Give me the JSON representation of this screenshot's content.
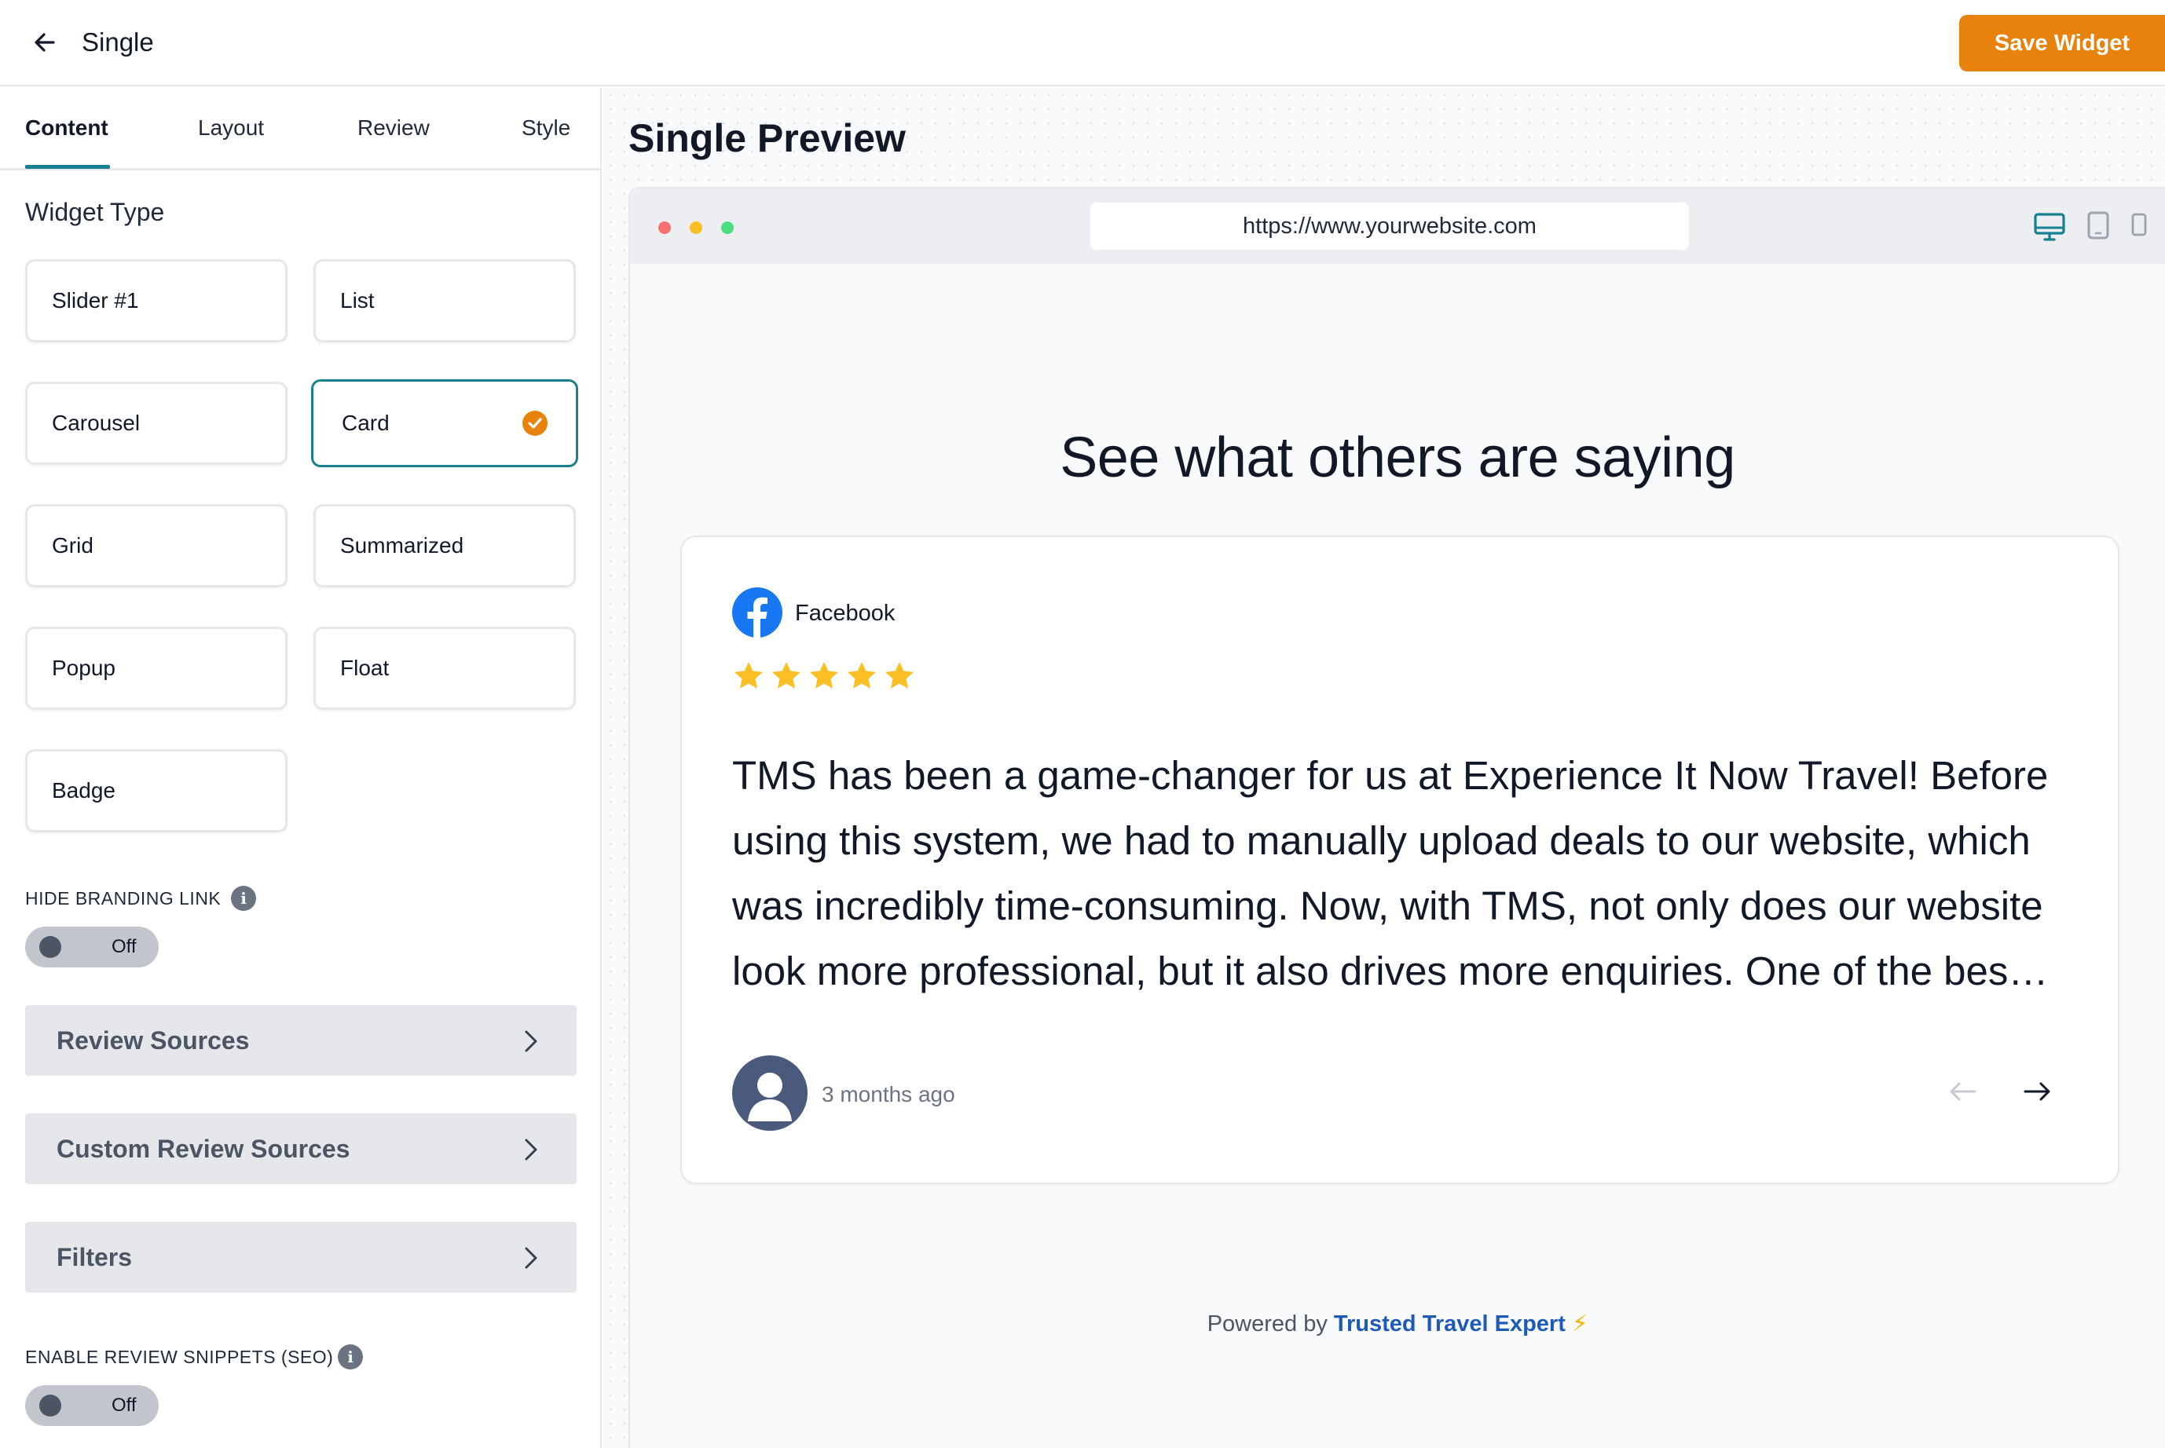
{
  "header": {
    "title": "Single",
    "save_label": "Save Widget"
  },
  "tabs": [
    {
      "label": "Content",
      "active": true
    },
    {
      "label": "Layout",
      "active": false
    },
    {
      "label": "Review",
      "active": false
    },
    {
      "label": "Style",
      "active": false
    }
  ],
  "widget_type": {
    "heading": "Widget Type",
    "options": [
      "Slider #1",
      "List",
      "Carousel",
      "Card",
      "Grid",
      "Summarized",
      "Popup",
      "Float",
      "Badge"
    ],
    "selected": "Card"
  },
  "hide_branding": {
    "label": "HIDE BRANDING LINK",
    "state": "Off"
  },
  "sections": [
    "Review Sources",
    "Custom Review Sources",
    "Filters"
  ],
  "review_snippets": {
    "label": "ENABLE REVIEW SNIPPETS (SEO)",
    "state": "Off"
  },
  "preview": {
    "title": "Single Preview",
    "url": "https://www.yourwebsite.com",
    "widget_heading": "See what others are saying",
    "review": {
      "source": "Facebook",
      "rating": 5,
      "text": "TMS has been a game-changer for us at Experience It Now Travel! Before using this system, we had to manually upload deals to our website, which was incredibly time-consuming. Now, with TMS, not only does our website look more professional, but it also drives more enquiries. One of the bes…",
      "time": "3 months ago"
    },
    "powered_by_prefix": "Powered by",
    "powered_by_link": "Trusted Travel Expert",
    "powered_by_icon": "⚡"
  },
  "colors": {
    "accent": "#e8820c",
    "teal": "#1b7f8c",
    "facebook": "#1877f2",
    "star": "#fbbf24",
    "link": "#1e5bb8"
  }
}
